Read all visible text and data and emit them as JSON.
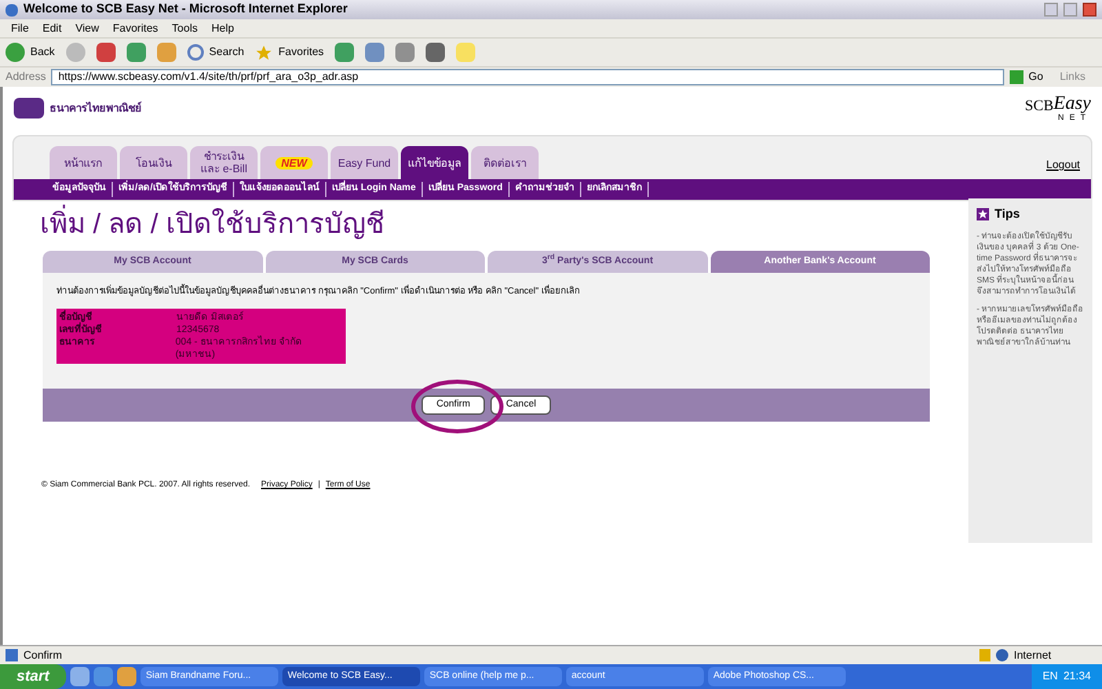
{
  "window": {
    "title": "Welcome to SCB Easy Net - Microsoft Internet Explorer"
  },
  "menu": [
    "File",
    "Edit",
    "View",
    "Favorites",
    "Tools",
    "Help"
  ],
  "toolbar": {
    "back": "Back",
    "search": "Search",
    "favorites": "Favorites"
  },
  "address": {
    "label": "Address",
    "url": "https://www.scbeasy.com/v1.4/site/th/prf/prf_ara_o3p_adr.asp",
    "go": "Go",
    "links": "Links"
  },
  "header": {
    "bank_name": "ธนาคารไทยพาณิชย์",
    "brand": "SCB",
    "brand_script": "Easy",
    "brand_sub": "NET"
  },
  "nav_tabs": [
    {
      "label": "หน้าแรก",
      "kind": "tab",
      "selected": false
    },
    {
      "label": "โอนเงิน",
      "kind": "tab",
      "selected": false
    },
    {
      "label": "ชำระเงิน\nและ e-Bill",
      "kind": "tab",
      "selected": false
    },
    {
      "label": "NEW",
      "kind": "badge",
      "selected": false
    },
    {
      "label": "Easy Fund",
      "kind": "tab",
      "selected": false
    },
    {
      "label": "แก้ไขข้อมูล",
      "kind": "tab",
      "selected": true
    },
    {
      "label": "ติดต่อเรา",
      "kind": "tab",
      "selected": false
    }
  ],
  "logout": "Logout",
  "submenu": [
    "ข้อมูลปัจจุบัน",
    "เพิ่ม/ลด/เปิดใช้บริการบัญชี",
    "ใบแจ้งยอดออนไลน์",
    "เปลี่ยน Login Name",
    "เปลี่ยน Password",
    "คำถามช่วยจำ",
    "ยกเลิกสมาชิก"
  ],
  "page_title": "เพิ่ม / ลด / เปิดใช้บริการบัญชี",
  "account_tabs": [
    {
      "label": "My SCB Account",
      "selected": false
    },
    {
      "label": "My SCB Cards",
      "selected": false
    },
    {
      "label": "3$^{rd}$ Party's SCB Account",
      "selected": false
    },
    {
      "label": "Another Bank's Account",
      "selected": true
    }
  ],
  "message": "ท่านต้องการเพิ่มข้อมูลบัญชีต่อไปนี้ในข้อมูลบัญชีบุคคลอื่นต่างธนาคาร กรุณาคลิก \"Confirm\" เพื่อดำเนินการต่อ หรือ คลิก \"Cancel\" เพื่อยกเลิก",
  "details": [
    {
      "label": "ชื่อบัญชี",
      "value": "นายดีด มิสเตอร์"
    },
    {
      "label": "เลขที่บัญชี",
      "value": "12345678"
    },
    {
      "label": "ธนาคาร",
      "value": "004 - ธนาคารกสิกรไทย จำกัด (มหาชน)"
    }
  ],
  "buttons": [
    "Confirm",
    "Cancel"
  ],
  "tips": {
    "title": "Tips",
    "items": [
      "- ท่านจะต้องเปิดใช้บัญชีรับเงินของ บุคคลที่ 3 ด้วย One-time Password ที่ธนาคารจะส่งไปให้ทางโทรศัพท์มือถือ SMS ที่ระบุในหน้าจอนี้ก่อน จึงสามารถทำการโอนเงินได้",
      "- หากหมายเลขโทรศัพท์มือถือหรืออีเมลของท่านไม่ถูกต้อง โปรดติดต่อ ธนาคารไทยพาณิชย์สาขาใกล้บ้านท่าน"
    ]
  },
  "footer": {
    "copyright": "© Siam Commercial Bank PCL. 2007. All rights reserved.",
    "links": [
      "Privacy Policy",
      "Term of Use"
    ],
    "separator": "|"
  },
  "status_bar": {
    "text": "Confirm",
    "zone": "Internet"
  },
  "taskbar": {
    "start": "start",
    "tasks": [
      {
        "label": "Siam Brandname Foru...",
        "selected": false
      },
      {
        "label": "Welcome to SCB Easy...",
        "selected": true
      },
      {
        "label": "SCB online (help me p...",
        "selected": false
      },
      {
        "label": "account",
        "selected": false
      },
      {
        "label": "Adobe Photoshop CS...",
        "selected": false
      }
    ],
    "lang": "EN",
    "time": "21:34"
  }
}
